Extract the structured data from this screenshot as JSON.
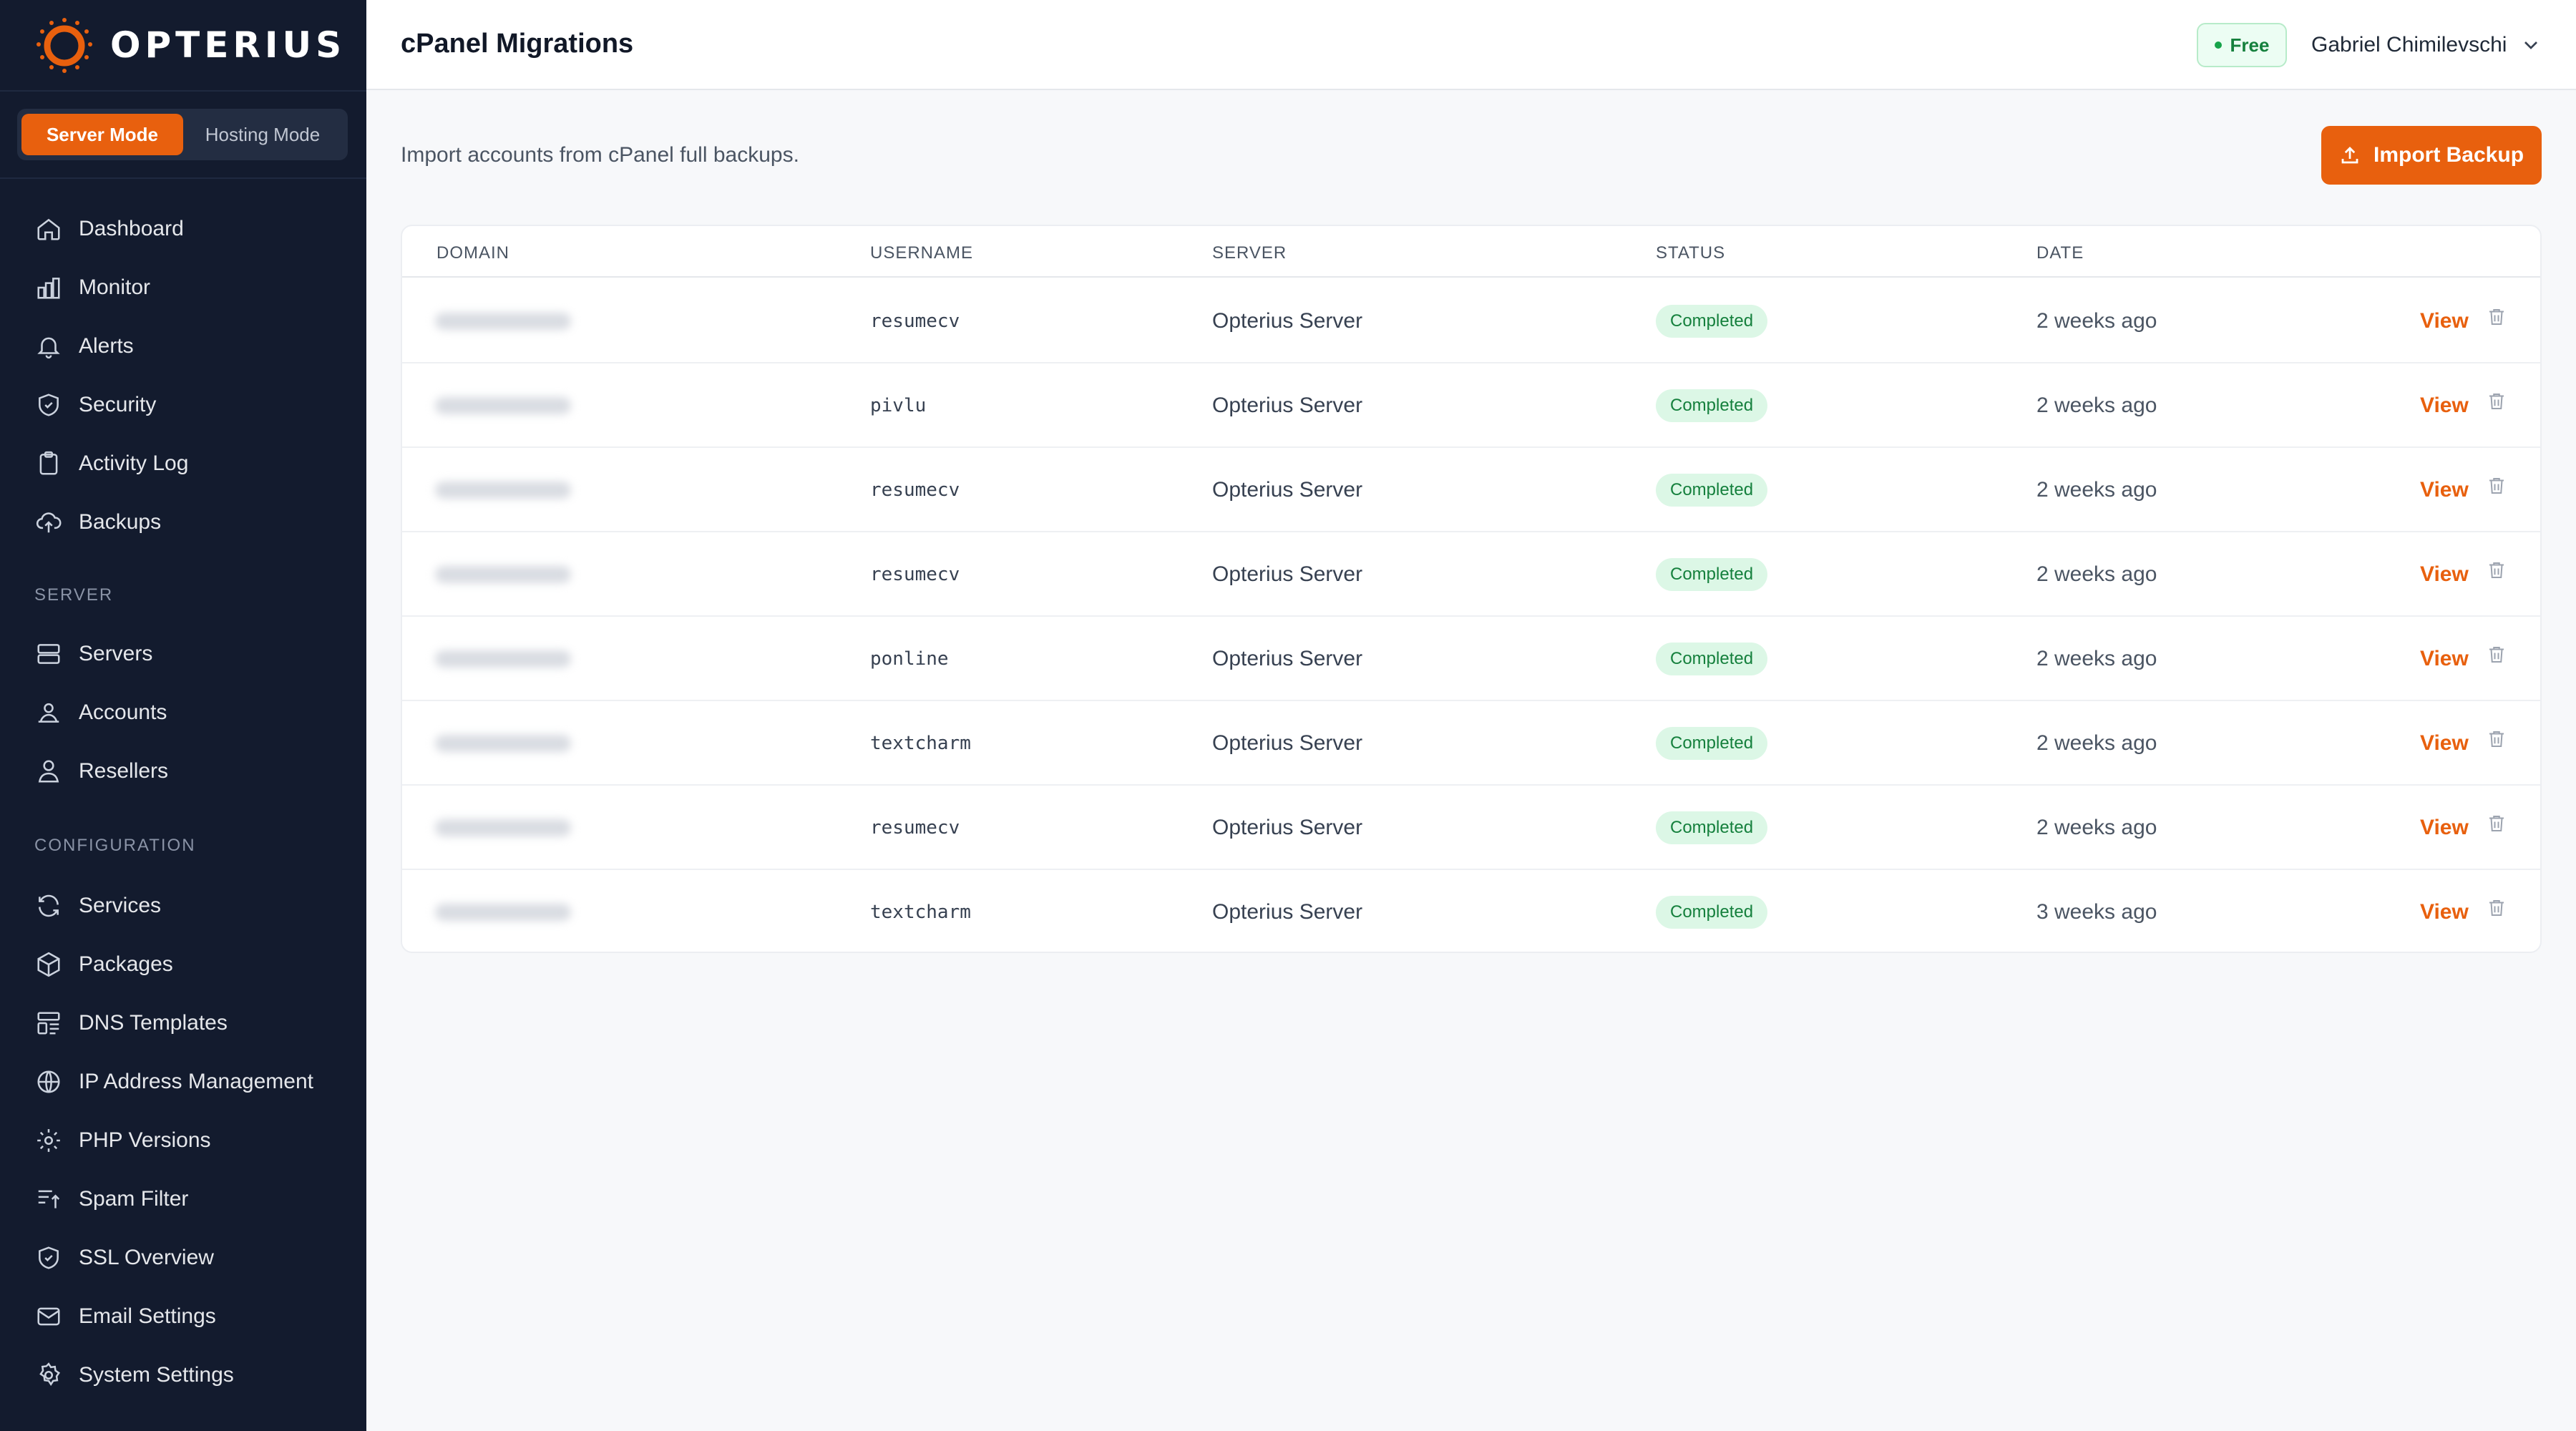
{
  "brand": {
    "name": "OPTERIUS",
    "accent": "#e8600e"
  },
  "mode_toggle": {
    "active": "Server Mode",
    "inactive": "Hosting Mode"
  },
  "sidebar": {
    "main_items": [
      {
        "label": "Dashboard",
        "icon": "home-icon"
      },
      {
        "label": "Monitor",
        "icon": "bar-chart-icon"
      },
      {
        "label": "Alerts",
        "icon": "bell-icon"
      },
      {
        "label": "Security",
        "icon": "shield-icon"
      },
      {
        "label": "Activity Log",
        "icon": "clipboard-icon"
      },
      {
        "label": "Backups",
        "icon": "cloud-upload-icon"
      }
    ],
    "server_section": "SERVER",
    "server_items": [
      {
        "label": "Servers",
        "icon": "server-icon"
      },
      {
        "label": "Accounts",
        "icon": "accounts-icon"
      },
      {
        "label": "Resellers",
        "icon": "users-icon"
      }
    ],
    "config_section": "CONFIGURATION",
    "config_items": [
      {
        "label": "Services",
        "icon": "refresh-icon"
      },
      {
        "label": "Packages",
        "icon": "package-icon"
      },
      {
        "label": "DNS Templates",
        "icon": "template-icon"
      },
      {
        "label": "IP Address Management",
        "icon": "globe-icon"
      },
      {
        "label": "PHP Versions",
        "icon": "gear-icon"
      },
      {
        "label": "Spam Filter",
        "icon": "filter-icon"
      },
      {
        "label": "SSL Overview",
        "icon": "shield-check-icon"
      },
      {
        "label": "Email Settings",
        "icon": "mail-icon"
      },
      {
        "label": "System Settings",
        "icon": "settings-icon"
      }
    ]
  },
  "header": {
    "title": "cPanel Migrations",
    "plan": "Free",
    "user": "Gabriel Chimilevschi"
  },
  "main": {
    "subtitle": "Import accounts from cPanel full backups.",
    "import_button": "Import Backup"
  },
  "table": {
    "columns": [
      "DOMAIN",
      "USERNAME",
      "SERVER",
      "STATUS",
      "DATE"
    ],
    "view_label": "View",
    "rows": [
      {
        "username": "resumecv",
        "server": "Opterius Server",
        "status": "Completed",
        "date": "2 weeks ago"
      },
      {
        "username": "pivlu",
        "server": "Opterius Server",
        "status": "Completed",
        "date": "2 weeks ago"
      },
      {
        "username": "resumecv",
        "server": "Opterius Server",
        "status": "Completed",
        "date": "2 weeks ago"
      },
      {
        "username": "resumecv",
        "server": "Opterius Server",
        "status": "Completed",
        "date": "2 weeks ago"
      },
      {
        "username": "ponline",
        "server": "Opterius Server",
        "status": "Completed",
        "date": "2 weeks ago"
      },
      {
        "username": "textcharm",
        "server": "Opterius Server",
        "status": "Completed",
        "date": "2 weeks ago"
      },
      {
        "username": "resumecv",
        "server": "Opterius Server",
        "status": "Completed",
        "date": "2 weeks ago"
      },
      {
        "username": "textcharm",
        "server": "Opterius Server",
        "status": "Completed",
        "date": "3 weeks ago"
      }
    ]
  }
}
